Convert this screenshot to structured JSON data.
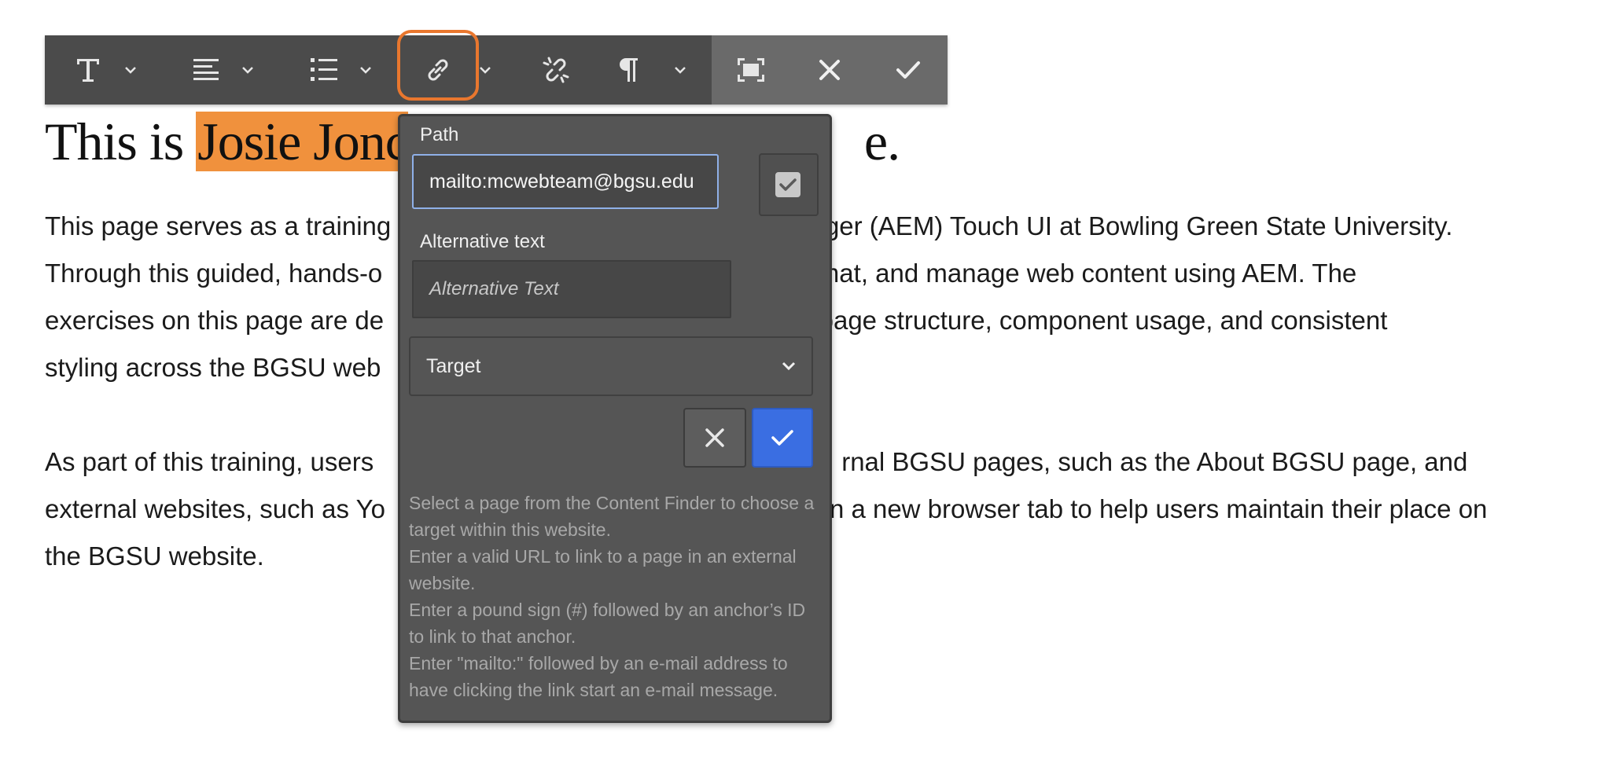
{
  "page": {
    "title_before": "This is ",
    "title_highlight": "Josie Jonc",
    "title_after_fragment": "e.",
    "paragraph1": [
      "This page serves as a training",
      "Through this guided, hands-o",
      "exercises on this page are de",
      "styling across the BGSU web"
    ],
    "paragraph1_right": [
      "nager (AEM) Touch UI at Bowling Green State University.",
      "format, and manage web content using AEM. The",
      "or page structure, component usage, and consistent",
      ""
    ],
    "paragraph2": [
      "As part of this training, users",
      "external websites, such as Yo",
      "the BGSU website."
    ],
    "paragraph2_right": [
      "rnal BGSU pages, such as the About BGSU page, and",
      "n a new browser tab to help users maintain their place on",
      ""
    ]
  },
  "toolbar": {
    "buttons": [
      {
        "name": "paragraph-format",
        "icon": "text-format-icon"
      },
      {
        "name": "justify",
        "icon": "align-justify-icon"
      },
      {
        "name": "lists",
        "icon": "bulleted-list-icon"
      },
      {
        "name": "link",
        "icon": "link-icon",
        "active": true
      },
      {
        "name": "unlink",
        "icon": "unlink-icon"
      },
      {
        "name": "paraformat",
        "icon": "pilcrow-icon"
      },
      {
        "name": "fullscreen",
        "icon": "fullscreen-icon"
      },
      {
        "name": "close",
        "icon": "close-icon"
      },
      {
        "name": "save",
        "icon": "checkmark-icon"
      }
    ],
    "active_outline_color": "#e9772e"
  },
  "link_dialog": {
    "path_label": "Path",
    "path_value": "mailto:mcwebteam@bgsu.edu",
    "alt_label": "Alternative text",
    "alt_placeholder": "Alternative Text",
    "target_label": "Target",
    "help_lines": [
      "Select a page from the Content Finder to choose a target within this website.",
      "Enter a valid URL to link to a page in an external website.",
      "Enter a pound sign (#) followed by an anchor’s ID to link to that anchor.",
      "Enter \"mailto:\" followed by an e-mail address to have clicking the link start an e-mail message."
    ],
    "confirm_color": "#3a6ee2"
  },
  "colors": {
    "highlight": "#f0913d",
    "toolbar_bg": "#4b4b4b",
    "dialog_bg": "#555555"
  }
}
